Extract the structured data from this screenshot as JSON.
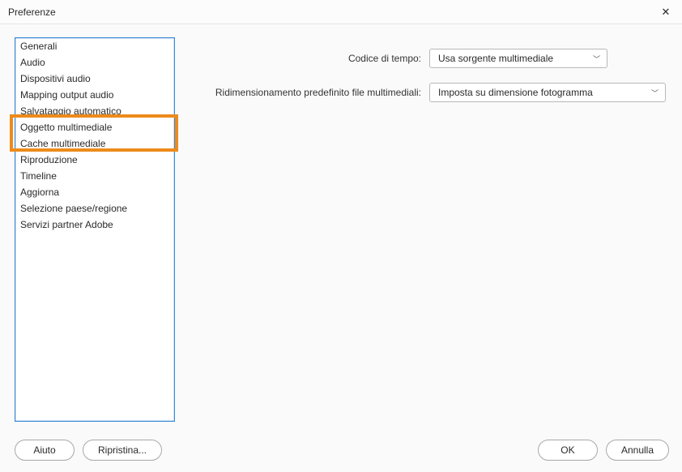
{
  "window": {
    "title": "Preferenze"
  },
  "sidebar": {
    "items": [
      {
        "label": "Generali"
      },
      {
        "label": "Audio"
      },
      {
        "label": "Dispositivi audio"
      },
      {
        "label": "Mapping output audio"
      },
      {
        "label": "Salvataggio automatico"
      },
      {
        "label": "Oggetto multimediale"
      },
      {
        "label": "Cache multimediale"
      },
      {
        "label": "Riproduzione"
      },
      {
        "label": "Timeline"
      },
      {
        "label": "Aggiorna"
      },
      {
        "label": "Selezione paese/regione"
      },
      {
        "label": "Servizi partner Adobe"
      }
    ]
  },
  "fields": {
    "timecode_label": "Codice di tempo:",
    "timecode_value": "Usa sorgente multimediale",
    "scaling_label": "Ridimensionamento predefinito file multimediali:",
    "scaling_value": "Imposta su dimensione fotogramma"
  },
  "buttons": {
    "help": "Aiuto",
    "reset": "Ripristina...",
    "ok": "OK",
    "cancel": "Annulla"
  }
}
